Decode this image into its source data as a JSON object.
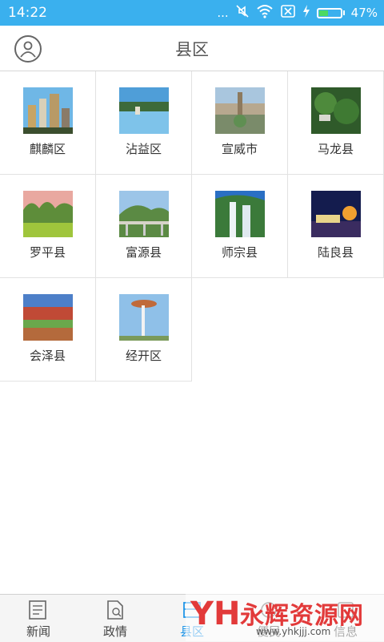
{
  "status_bar": {
    "time": "14:22",
    "dots": "...",
    "battery_percent": "47%",
    "battery_level": 0.47,
    "icons": [
      "mute-icon",
      "wifi-icon",
      "sim-icon",
      "charging-icon",
      "battery-icon"
    ]
  },
  "header": {
    "title": "县区",
    "avatar_icon": "user-avatar-icon"
  },
  "districts": [
    {
      "label": "麒麟区",
      "thumb": "city-skyline"
    },
    {
      "label": "沾益区",
      "thumb": "lake-park"
    },
    {
      "label": "宣威市",
      "thumb": "city-square"
    },
    {
      "label": "马龙县",
      "thumb": "green-hills"
    },
    {
      "label": "罗平县",
      "thumb": "karst-fields"
    },
    {
      "label": "富源县",
      "thumb": "bridge-hill"
    },
    {
      "label": "师宗县",
      "thumb": "waterfall"
    },
    {
      "label": "陆良县",
      "thumb": "night-lights"
    },
    {
      "label": "会泽县",
      "thumb": "red-land"
    },
    {
      "label": "经开区",
      "thumb": "tower"
    }
  ],
  "tabs": [
    {
      "label": "新闻",
      "icon": "newspaper-icon"
    },
    {
      "label": "政情",
      "icon": "document-icon"
    },
    {
      "label": "县区",
      "icon": "district-icon",
      "active": true
    },
    {
      "label": "便民",
      "icon": "service-icon"
    },
    {
      "label": "信息",
      "icon": "info-icon"
    }
  ],
  "watermark": {
    "logo": "YH",
    "title": "永辉资源网",
    "url": "www.yhkjjj.com"
  },
  "colors": {
    "status_bar": "#3ab0ee",
    "active_tab": "#2196e8",
    "watermark": "#e23a3a"
  }
}
